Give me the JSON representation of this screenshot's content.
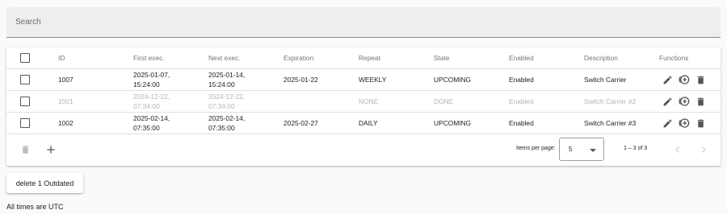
{
  "search": {
    "placeholder": "Search",
    "value": ""
  },
  "table": {
    "columns": {
      "id": "ID",
      "first_exec": "First exec.",
      "next_exec": "Next exec.",
      "expiration": "Expiration",
      "repeat": "Repeat",
      "state": "State",
      "enabled": "Enabled",
      "description": "Description",
      "functions": "Functions"
    },
    "rows": [
      {
        "id": "1007",
        "first_date": "2025-01-07,",
        "first_time": "15:24:00",
        "next_date": "2025-01-14,",
        "next_time": "15:24:00",
        "expiration": "2025-01-22",
        "repeat": "WEEKLY",
        "state": "UPCOMING",
        "enabled": "Enabled",
        "description": "Switch Carrier",
        "disabled": false
      },
      {
        "id": "1001",
        "first_date": "2024-12-22,",
        "first_time": "07:34:00",
        "next_date": "2024-12-22,",
        "next_time": "07:34:00",
        "expiration": "",
        "repeat": "NONE",
        "state": "DONE",
        "enabled": "Enabled",
        "description": "Switch Carrier #2",
        "disabled": true
      },
      {
        "id": "1002",
        "first_date": "2025-02-14,",
        "first_time": "07:35:00",
        "next_date": "2025-02-14,",
        "next_time": "07:35:00",
        "expiration": "2025-02-27",
        "repeat": "DAILY",
        "state": "UPCOMING",
        "enabled": "Enabled",
        "description": "Switch Carrier #3",
        "disabled": false
      }
    ]
  },
  "paginator": {
    "items_per_page_label": "Items per page:",
    "items_per_page": "5",
    "range_label": "1 – 3 of 3"
  },
  "actions": {
    "delete_outdated_label": "delete 1 Outdated"
  },
  "footer_note": "All times are UTC",
  "icons": {
    "edit": "pencil-icon",
    "duplicate": "add-circle-icon",
    "delete": "trash-icon",
    "bulk_delete": "trash-icon",
    "add": "plus-icon",
    "prev_page": "chevron-left-icon",
    "next_page": "chevron-right-icon"
  },
  "colors": {
    "icon": "#555555",
    "disabled_text": "#b4b4b4",
    "divider": "#e0e0e0"
  }
}
